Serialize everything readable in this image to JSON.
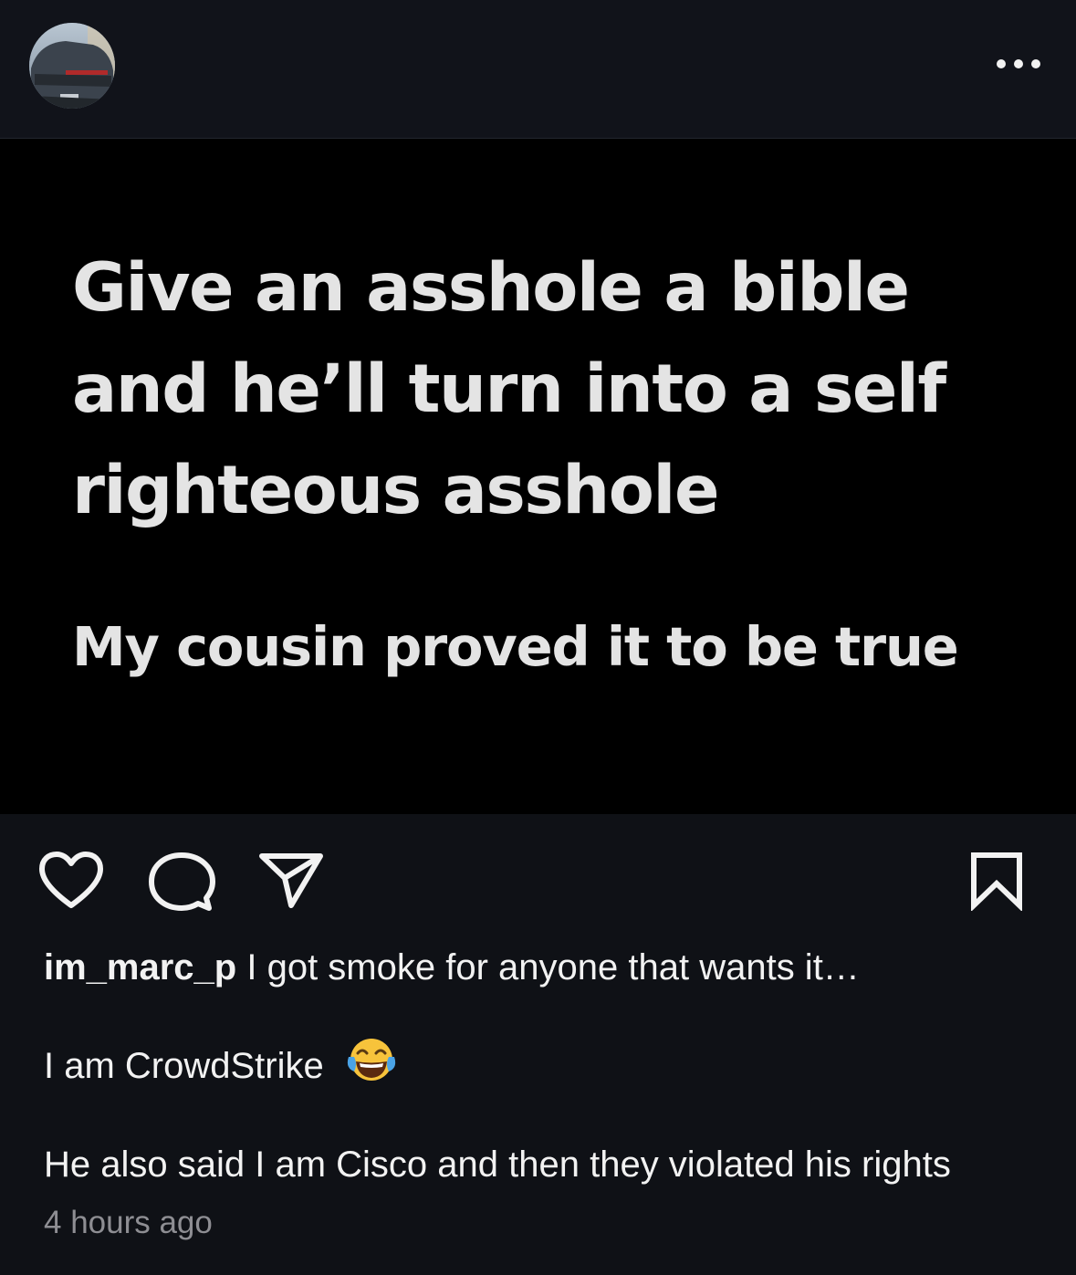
{
  "header": {
    "avatar_alt": "profile picture",
    "more_icon": "more-horizontal-icon"
  },
  "post": {
    "quote": "Give an asshole a bible and he’ll turn into a self righteous asshole",
    "subquote": "My cousin proved it to be true"
  },
  "actions": {
    "like_icon": "heart-icon",
    "comment_icon": "comment-icon",
    "share_icon": "send-icon",
    "save_icon": "bookmark-icon"
  },
  "caption": {
    "username": "im_marc_p",
    "text": "I got smoke for anyone that wants it…",
    "line2": "I am CrowdStrike",
    "line2_emoji": "face-with-tears-of-joy-emoji",
    "line3": "He also said I am Cisco and then they violated his rights"
  },
  "timestamp": "4 hours ago"
}
